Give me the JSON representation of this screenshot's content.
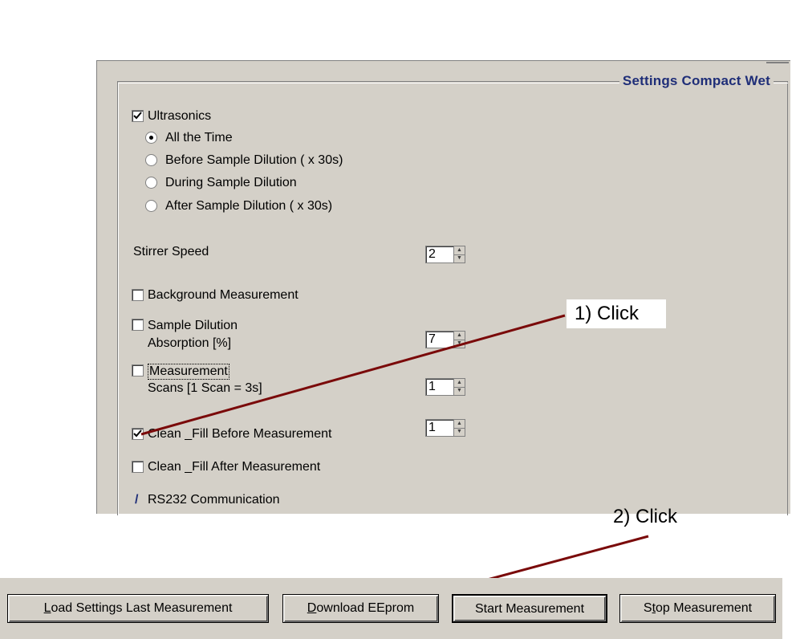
{
  "group": {
    "legend": "Settings Compact Wet"
  },
  "ultrasonics": {
    "label": "Ultrasonics",
    "checked": true,
    "options": [
      {
        "label": "All the Time",
        "selected": true
      },
      {
        "label": "Before Sample Dilution ( x 30s)",
        "selected": false
      },
      {
        "label": "During Sample Dilution",
        "selected": false
      },
      {
        "label": "After Sample Dilution ( x 30s)",
        "selected": false
      }
    ]
  },
  "stirrer": {
    "label": "Stirrer Speed",
    "value": "2"
  },
  "background": {
    "label": "Background Measurement",
    "checked": false
  },
  "dilution": {
    "label": "Sample Dilution",
    "checked": false,
    "sub_label": "Absorption [%]",
    "value": "7"
  },
  "measurement": {
    "label": "Measurement",
    "checked": false,
    "sub_label": "Scans [1 Scan = 3s]",
    "value": "1"
  },
  "clean_before": {
    "label": "Clean _Fill Before Measurement",
    "checked": true,
    "value": "1"
  },
  "clean_after": {
    "label": "Clean _Fill After Measurement",
    "checked": false
  },
  "rs232": {
    "icon": "/",
    "label": "RS232 Communication"
  },
  "annotations": {
    "step1": "1)  Click",
    "step2": "2) Click"
  },
  "buttons": {
    "load": {
      "mnemonic": "L",
      "rest": "oad Settings Last Measurement"
    },
    "download": {
      "mnemonic": "D",
      "rest": "ownload EEprom"
    },
    "start": {
      "label": "Start Measurement"
    },
    "stop": {
      "pre": "S",
      "mnemonic": "t",
      "rest": "op Measurement"
    }
  },
  "colors": {
    "panel": "#d4d0c8",
    "legend": "#1f2e78",
    "annotation_line": "#7a0a0a"
  }
}
